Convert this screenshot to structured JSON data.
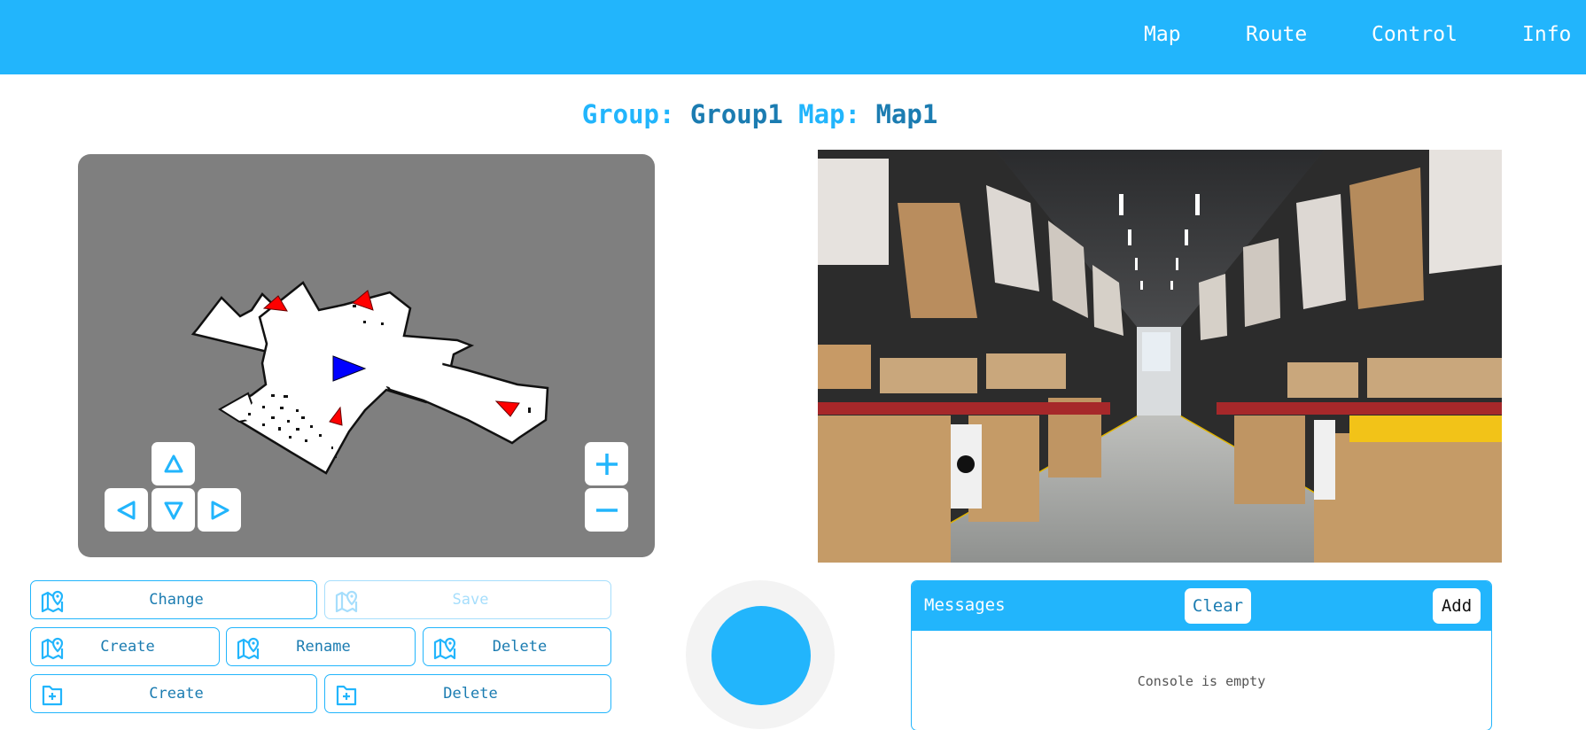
{
  "header": {
    "nav": [
      {
        "label": "Map"
      },
      {
        "label": "Route"
      },
      {
        "label": "Control"
      },
      {
        "label": "Info"
      }
    ]
  },
  "title": {
    "group_label": "Group:",
    "group_value": "Group1",
    "map_label": "Map:",
    "map_value": "Map1"
  },
  "map_view": {
    "robot_color": "#0000ff",
    "waypoint_color": "#ff0000",
    "pan_controls": [
      "pan-up",
      "pan-left",
      "pan-down",
      "pan-right"
    ],
    "zoom_controls": [
      "zoom-in",
      "zoom-out"
    ]
  },
  "camera": {
    "description": "Warehouse aisle camera feed"
  },
  "actions": {
    "map_change": "Change",
    "map_save": "Save",
    "map_create": "Create",
    "map_rename": "Rename",
    "map_delete": "Delete",
    "group_create": "Create",
    "group_delete": "Delete"
  },
  "messages": {
    "title": "Messages",
    "clear": "Clear",
    "add": "Add",
    "empty_text": "Console is empty"
  },
  "colors": {
    "accent": "#22b5fc",
    "accent_dark": "#1b7cb1"
  }
}
